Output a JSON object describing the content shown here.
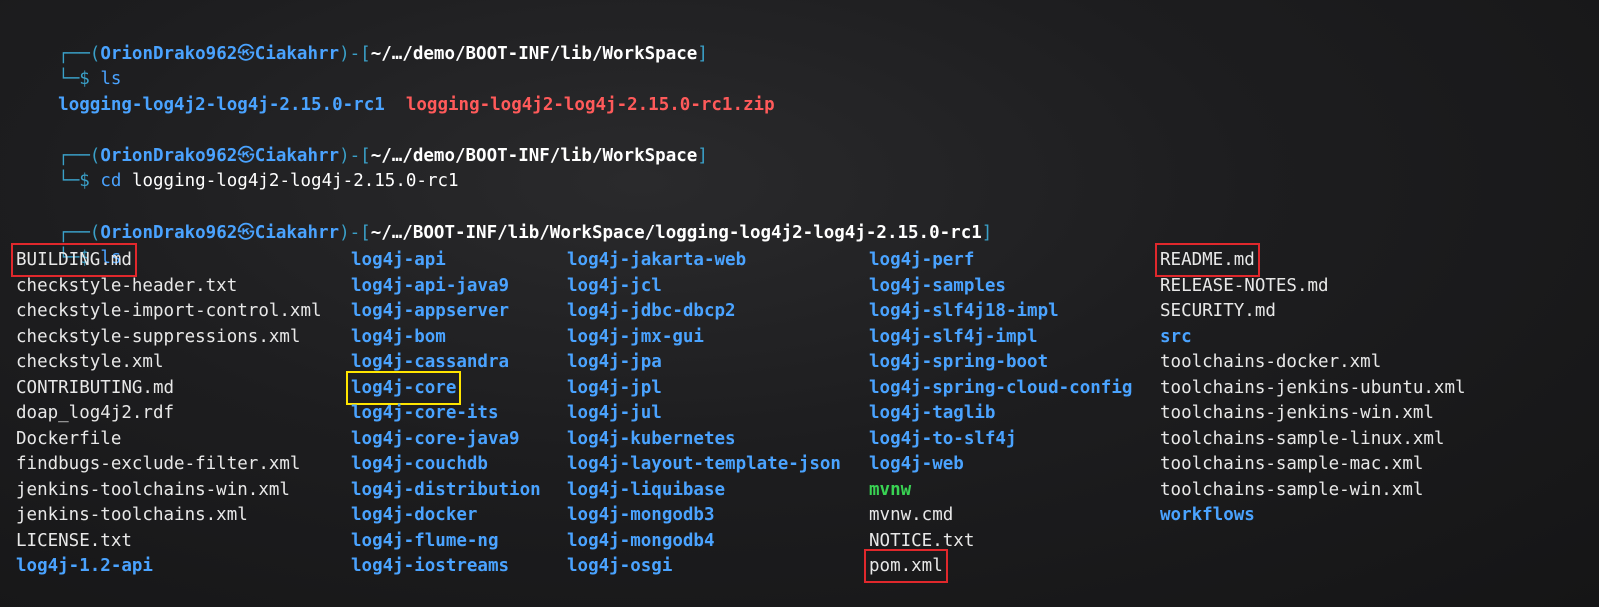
{
  "prompts": [
    {
      "open": "┌──(",
      "user": "OrionDrako962",
      "skull": "㉿",
      "host": "Ciakahrr",
      "sep": ")-[",
      "path": "~/…/demo/BOOT-INF/lib/WorkSpace",
      "close": "]",
      "dollar": "└─$",
      "cmd": "ls",
      "arg": ""
    },
    {
      "open": "┌──(",
      "user": "OrionDrako962",
      "skull": "㉿",
      "host": "Ciakahrr",
      "sep": ")-[",
      "path": "~/…/demo/BOOT-INF/lib/WorkSpace",
      "close": "]",
      "dollar": "└─$",
      "cmd": "cd",
      "arg": "logging-log4j2-log4j-2.15.0-rc1"
    },
    {
      "open": "┌──(",
      "user": "OrionDrako962",
      "skull": "㉿",
      "host": "Ciakahrr",
      "sep": ")-[",
      "path": "~/…/BOOT-INF/lib/WorkSpace/logging-log4j2-log4j-2.15.0-rc1",
      "close": "]",
      "dollar": "└─$",
      "cmd": "ls",
      "arg": ""
    }
  ],
  "first_ls": {
    "dir": "logging-log4j2-log4j-2.15.0-rc1",
    "zip": "logging-log4j2-log4j-2.15.0-rc1.zip"
  },
  "listing": {
    "col1": [
      {
        "name": "BUILDING.md",
        "kind": "file",
        "highlight": "red"
      },
      {
        "name": "checkstyle-header.txt",
        "kind": "file"
      },
      {
        "name": "checkstyle-import-control.xml",
        "kind": "file"
      },
      {
        "name": "checkstyle-suppressions.xml",
        "kind": "file"
      },
      {
        "name": "checkstyle.xml",
        "kind": "file"
      },
      {
        "name": "CONTRIBUTING.md",
        "kind": "file"
      },
      {
        "name": "doap_log4j2.rdf",
        "kind": "file"
      },
      {
        "name": "Dockerfile",
        "kind": "file"
      },
      {
        "name": "findbugs-exclude-filter.xml",
        "kind": "file"
      },
      {
        "name": "jenkins-toolchains-win.xml",
        "kind": "file"
      },
      {
        "name": "jenkins-toolchains.xml",
        "kind": "file"
      },
      {
        "name": "LICENSE.txt",
        "kind": "file"
      },
      {
        "name": "log4j-1.2-api",
        "kind": "dir"
      }
    ],
    "col2": [
      {
        "name": "log4j-api",
        "kind": "dir"
      },
      {
        "name": "log4j-api-java9",
        "kind": "dir"
      },
      {
        "name": "log4j-appserver",
        "kind": "dir"
      },
      {
        "name": "log4j-bom",
        "kind": "dir"
      },
      {
        "name": "log4j-cassandra",
        "kind": "dir"
      },
      {
        "name": "log4j-core",
        "kind": "dir",
        "highlight": "yellow"
      },
      {
        "name": "log4j-core-its",
        "kind": "dir"
      },
      {
        "name": "log4j-core-java9",
        "kind": "dir"
      },
      {
        "name": "log4j-couchdb",
        "kind": "dir"
      },
      {
        "name": "log4j-distribution",
        "kind": "dir"
      },
      {
        "name": "log4j-docker",
        "kind": "dir"
      },
      {
        "name": "log4j-flume-ng",
        "kind": "dir"
      },
      {
        "name": "log4j-iostreams",
        "kind": "dir"
      }
    ],
    "col3": [
      {
        "name": "log4j-jakarta-web",
        "kind": "dir"
      },
      {
        "name": "log4j-jcl",
        "kind": "dir"
      },
      {
        "name": "log4j-jdbc-dbcp2",
        "kind": "dir"
      },
      {
        "name": "log4j-jmx-gui",
        "kind": "dir"
      },
      {
        "name": "log4j-jpa",
        "kind": "dir"
      },
      {
        "name": "log4j-jpl",
        "kind": "dir"
      },
      {
        "name": "log4j-jul",
        "kind": "dir"
      },
      {
        "name": "log4j-kubernetes",
        "kind": "dir"
      },
      {
        "name": "log4j-layout-template-json",
        "kind": "dir"
      },
      {
        "name": "log4j-liquibase",
        "kind": "dir"
      },
      {
        "name": "log4j-mongodb3",
        "kind": "dir"
      },
      {
        "name": "log4j-mongodb4",
        "kind": "dir"
      },
      {
        "name": "log4j-osgi",
        "kind": "dir"
      }
    ],
    "col4": [
      {
        "name": "log4j-perf",
        "kind": "dir"
      },
      {
        "name": "log4j-samples",
        "kind": "dir"
      },
      {
        "name": "log4j-slf4j18-impl",
        "kind": "dir"
      },
      {
        "name": "log4j-slf4j-impl",
        "kind": "dir"
      },
      {
        "name": "log4j-spring-boot",
        "kind": "dir"
      },
      {
        "name": "log4j-spring-cloud-config",
        "kind": "dir"
      },
      {
        "name": "log4j-taglib",
        "kind": "dir"
      },
      {
        "name": "log4j-to-slf4j",
        "kind": "dir"
      },
      {
        "name": "log4j-web",
        "kind": "dir"
      },
      {
        "name": "mvnw",
        "kind": "exec"
      },
      {
        "name": "mvnw.cmd",
        "kind": "file"
      },
      {
        "name": "NOTICE.txt",
        "kind": "file"
      },
      {
        "name": "pom.xml",
        "kind": "file",
        "highlight": "red"
      }
    ],
    "col5": [
      {
        "name": "README.md",
        "kind": "file",
        "highlight": "red"
      },
      {
        "name": "RELEASE-NOTES.md",
        "kind": "file"
      },
      {
        "name": "SECURITY.md",
        "kind": "file"
      },
      {
        "name": "src",
        "kind": "dir"
      },
      {
        "name": "toolchains-docker.xml",
        "kind": "file"
      },
      {
        "name": "toolchains-jenkins-ubuntu.xml",
        "kind": "file"
      },
      {
        "name": "toolchains-jenkins-win.xml",
        "kind": "file"
      },
      {
        "name": "toolchains-sample-linux.xml",
        "kind": "file"
      },
      {
        "name": "toolchains-sample-mac.xml",
        "kind": "file"
      },
      {
        "name": "toolchains-sample-win.xml",
        "kind": "file"
      },
      {
        "name": "workflows",
        "kind": "dir"
      }
    ]
  },
  "colors": {
    "prompt": "#4aa3ff",
    "dir": "#4aa3ff",
    "zip": "#ff5a5a",
    "exec": "#39d353",
    "highlight_red": "#e0282c",
    "highlight_yellow": "#ffe500"
  }
}
